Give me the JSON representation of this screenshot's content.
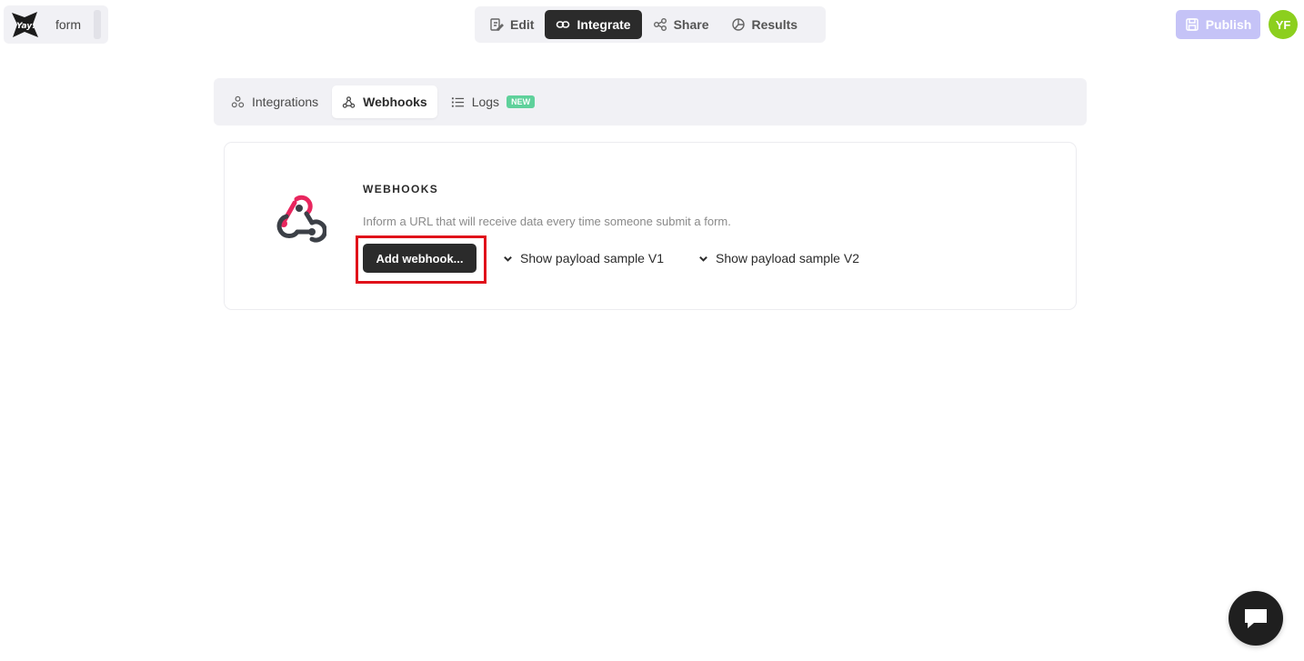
{
  "brand": {
    "form_name": "form",
    "logo_icon": "yay-logo"
  },
  "topnav": {
    "tabs": [
      {
        "label": "Edit",
        "icon": "edit-icon"
      },
      {
        "label": "Integrate",
        "icon": "link-icon",
        "active": true
      },
      {
        "label": "Share",
        "icon": "share-icon"
      },
      {
        "label": "Results",
        "icon": "pie-chart-icon"
      }
    ]
  },
  "header": {
    "publish_label": "Publish",
    "avatar_initials": "YF"
  },
  "subnav": {
    "tabs": [
      {
        "label": "Integrations",
        "icon": "integrations-icon"
      },
      {
        "label": "Webhooks",
        "icon": "webhook-icon",
        "active": true
      },
      {
        "label": "Logs",
        "icon": "list-icon",
        "badge": "NEW"
      }
    ]
  },
  "card": {
    "title": "WEBHOOKS",
    "description": "Inform a URL that will receive data every time someone submit a form.",
    "add_button": "Add webhook...",
    "payload_v1": "Show payload sample V1",
    "payload_v2": "Show payload sample V2"
  },
  "colors": {
    "accent_dark": "#2b2b2b",
    "publish_disabled": "#c5c3f7",
    "avatar": "#8ccf1e",
    "badge_new": "#5fd19b",
    "highlight": "#e0101a",
    "webhook_pink": "#e8265e"
  }
}
